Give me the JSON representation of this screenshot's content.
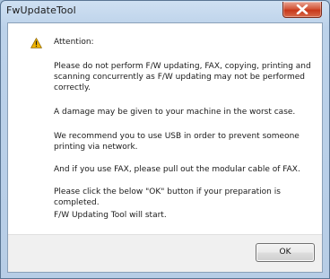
{
  "window": {
    "title": "FwUpdateTool"
  },
  "dialog": {
    "icon": "warning-icon",
    "messages": [
      "Attention:",
      "Please do not perform F/W updating, FAX, copying, printing and scanning concurrently as F/W updating may not be performed correctly.",
      "A damage may be given to your machine in the worst case.",
      "We recommend you to use USB in order to prevent someone printing via network.",
      "And if you use FAX, please pull out the modular cable of FAX.",
      "Please click the below \"OK\" button if your preparation is completed.",
      "F/W Updating Tool will start."
    ],
    "ok_label": "OK"
  },
  "colors": {
    "warning": "#f0b400",
    "close_button": "#c7381a"
  }
}
